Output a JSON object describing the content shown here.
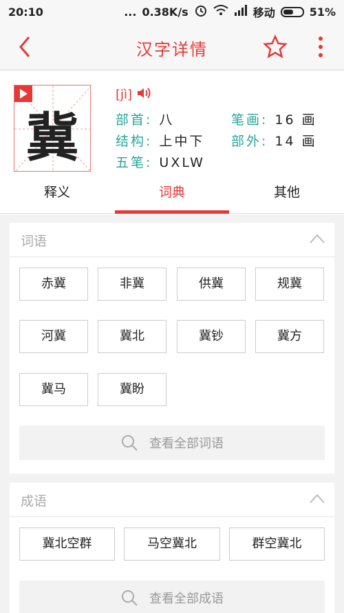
{
  "status": {
    "time": "20:10",
    "dots": "...",
    "speed": "0.38K/s",
    "carrier": "移动",
    "battery": "51%"
  },
  "appbar": {
    "title": "汉字详情",
    "back_icon": "chevron-left-icon",
    "star_icon": "star-icon",
    "more_icon": "more-vertical-icon"
  },
  "char": {
    "glyph": "冀",
    "pinyin": "[jì]",
    "radical_label": "部首:",
    "radical": "八",
    "strokes_label": "笔画:",
    "strokes": "16 画",
    "structure_label": "结构:",
    "structure": "上中下",
    "outer_label": "部外:",
    "outer": "14 画",
    "wubi_label": "五笔:",
    "wubi": "UXLW"
  },
  "tabs": [
    "释义",
    "词典",
    "其他"
  ],
  "active_tab": "词典",
  "words": {
    "title": "词语",
    "items": [
      "赤冀",
      "非冀",
      "供冀",
      "规冀",
      "河冀",
      "冀北",
      "冀钞",
      "冀方",
      "冀马",
      "冀盼"
    ],
    "view_all": "查看全部词语"
  },
  "idioms": {
    "title": "成语",
    "items": [
      "冀北空群",
      "马空冀北",
      "群空冀北"
    ],
    "view_all": "查看全部成语"
  },
  "colors": {
    "accent": "#e53935",
    "label": "#26a69a"
  }
}
